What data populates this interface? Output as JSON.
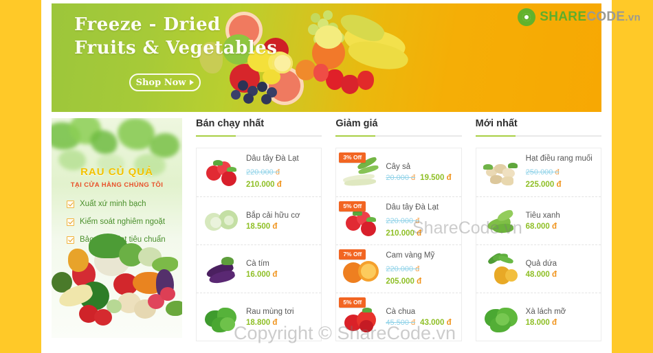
{
  "theme": {
    "page_bg": "#FFC928",
    "accent_green": "#8FBF26",
    "badge_orange": "#F26522",
    "heading_underline": "#A8CF42",
    "currency_symbol": "đ"
  },
  "logo": {
    "name": "sharecode-logo",
    "part_share": "SHARE",
    "part_code": "CODE",
    "part_tld": ".vn"
  },
  "hero": {
    "title_line1": "Freeze - Dried",
    "title_line2": "Fruits & Vegetables",
    "cta_label": "Shop Now"
  },
  "promo": {
    "title": "RAU CỦ QUẢ",
    "subtitle": "TẠI CỬA HÀNG CHÚNG TÔI",
    "bullets": [
      {
        "text": "Xuất xứ minh bạch"
      },
      {
        "text": "Kiểm soát nghiêm ngoặt"
      },
      {
        "text": "Bảo quản đạt tiêu chuẩn"
      }
    ]
  },
  "columns": [
    {
      "heading": "Bán chạy nhất",
      "products": [
        {
          "name": "Dâu tây Đà Lạt",
          "old_price": "220.000",
          "price": "210.000",
          "badge": null,
          "layout": "stack",
          "thumb": "strawberry"
        },
        {
          "name": "Bắp cải hữu cơ",
          "old_price": null,
          "price": "18.500",
          "badge": null,
          "layout": "solo",
          "thumb": "cabbage"
        },
        {
          "name": "Cà tím",
          "old_price": null,
          "price": "16.000",
          "badge": null,
          "layout": "solo",
          "thumb": "eggplant"
        },
        {
          "name": "Rau mùng tơi",
          "old_price": null,
          "price": "18.800",
          "badge": null,
          "layout": "solo",
          "thumb": "leafygreen"
        }
      ]
    },
    {
      "heading": "Giảm giá",
      "products": [
        {
          "name": "Cây sả",
          "old_price": "20.000",
          "price": "19.500",
          "badge": "3% Off",
          "layout": "inline",
          "thumb": "lemongrass"
        },
        {
          "name": "Dâu tây Đà Lạt",
          "old_price": "220.000",
          "price": "210.000",
          "badge": "5% Off",
          "layout": "stack",
          "thumb": "strawberry"
        },
        {
          "name": "Cam vàng Mỹ",
          "old_price": "220.000",
          "price": "205.000",
          "badge": "7% Off",
          "layout": "stack",
          "thumb": "orange"
        },
        {
          "name": "Cà chua",
          "old_price": "45.500",
          "price": "43.000",
          "badge": "5% Off",
          "layout": "inline",
          "thumb": "tomato"
        }
      ]
    },
    {
      "heading": "Mới nhất",
      "products": [
        {
          "name": "Hạt điều rang muối",
          "old_price": "250.000",
          "price": "225.000",
          "badge": null,
          "layout": "stack",
          "thumb": "cashew"
        },
        {
          "name": "Tiêu xanh",
          "old_price": null,
          "price": "68.000",
          "badge": null,
          "layout": "solo",
          "thumb": "greenpepper"
        },
        {
          "name": "Quả dứa",
          "old_price": null,
          "price": "48.000",
          "badge": null,
          "layout": "solo",
          "thumb": "pineapple"
        },
        {
          "name": "Xà lách mỡ",
          "old_price": null,
          "price": "18.000",
          "badge": null,
          "layout": "solo",
          "thumb": "lettuce"
        }
      ]
    }
  ],
  "watermarks": {
    "middle": "ShareCode.vn",
    "bottom": "Copyright © ShareCode.vn"
  }
}
